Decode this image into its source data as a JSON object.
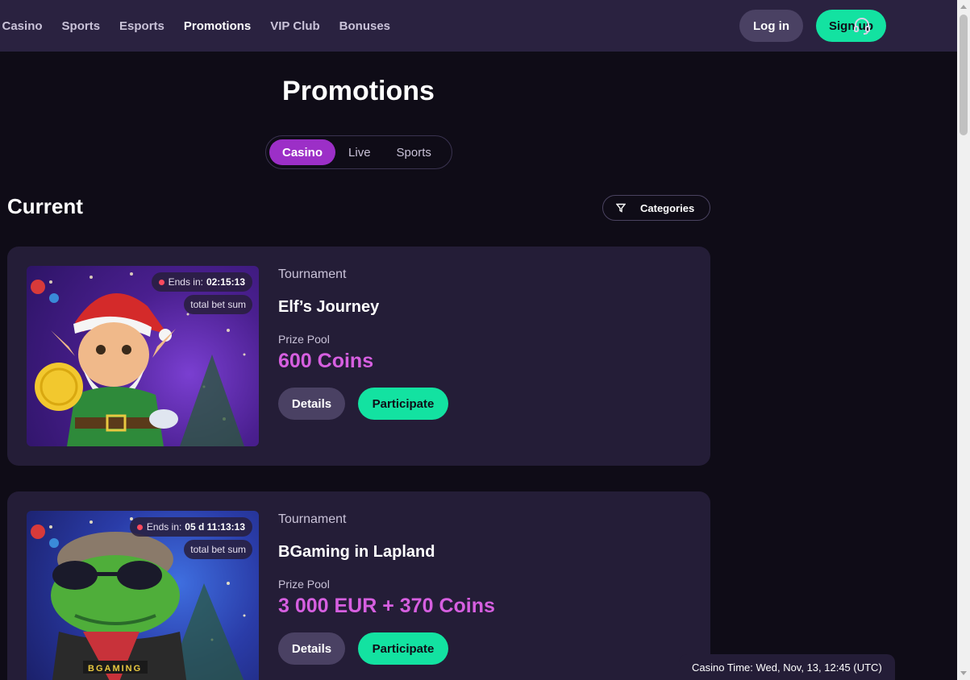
{
  "nav": {
    "items": [
      {
        "label": "e Casino",
        "active": false
      },
      {
        "label": "Sports",
        "active": false
      },
      {
        "label": "Esports",
        "active": false
      },
      {
        "label": "Promotions",
        "active": true
      },
      {
        "label": "VIP Club",
        "active": false
      },
      {
        "label": "Bonuses",
        "active": false
      }
    ],
    "login_label": "Log in",
    "signup_label": "Sign up",
    "support_icon": "headset-icon"
  },
  "page": {
    "title": "Promotions",
    "tabs": [
      {
        "label": "Casino",
        "active": true
      },
      {
        "label": "Live",
        "active": false
      },
      {
        "label": "Sports",
        "active": false
      }
    ],
    "section_title": "Current",
    "categories_label": "Categories",
    "categories_icon": "filter-icon"
  },
  "promotions": [
    {
      "type": "Tournament",
      "name": "Elf’s Journey",
      "ends_label": "Ends in:",
      "ends_value": "02:15:13",
      "badge": "total bet sum",
      "pool_label": "Prize Pool",
      "pool_value": "600 Coins",
      "details_label": "Details",
      "participate_label": "Participate"
    },
    {
      "type": "Tournament",
      "name": "BGaming in Lapland",
      "ends_label": "Ends in:",
      "ends_value": "05 d 11:13:13",
      "badge": "total bet sum",
      "pool_label": "Prize Pool",
      "pool_value": "3 000 EUR + 370 Coins",
      "details_label": "Details",
      "participate_label": "Participate",
      "image_text": "BGAMING"
    }
  ],
  "footer": {
    "casino_time": "Casino Time: Wed, Nov, 13, 12:45 (UTC)"
  },
  "colors": {
    "accent_green": "#13e2a1",
    "accent_purple": "#9c2fc7",
    "prize_pink": "#d65fe0",
    "topbar": "#2a2240",
    "card": "#241d37"
  }
}
